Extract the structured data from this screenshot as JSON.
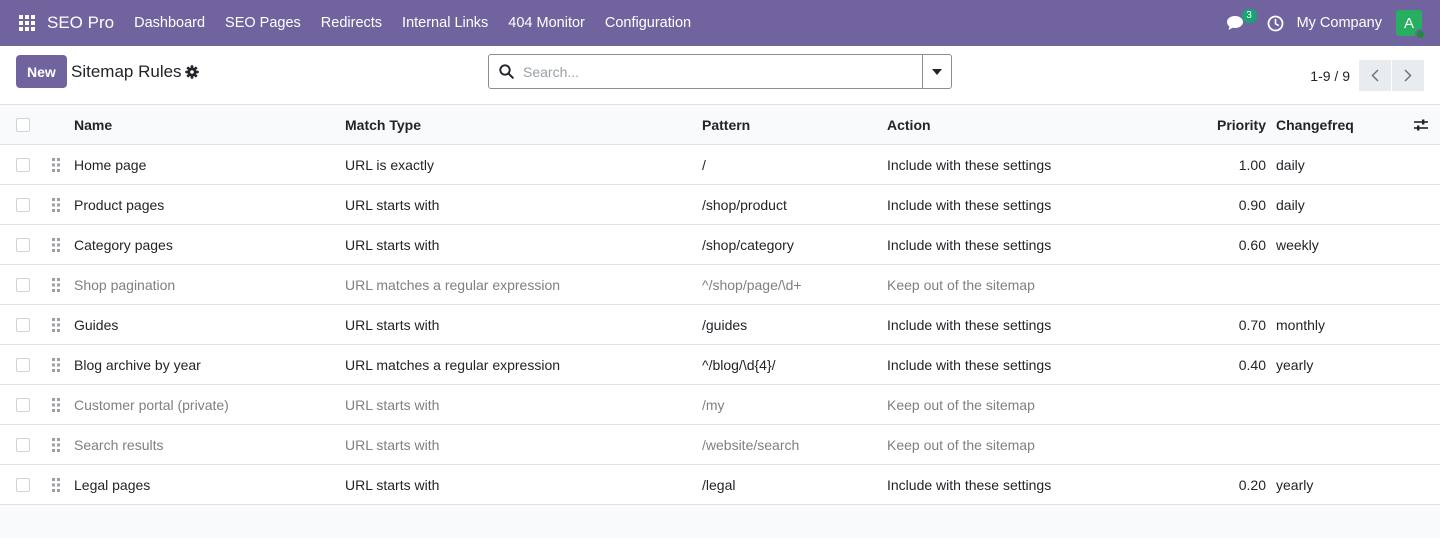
{
  "topbar": {
    "app_name": "SEO Pro",
    "menu": [
      "Dashboard",
      "SEO Pages",
      "Redirects",
      "Internal Links",
      "404 Monitor",
      "Configuration"
    ],
    "messages_count": "3",
    "company": "My Company",
    "avatar_letter": "A",
    "colors": {
      "bar": "#71639e",
      "avatar": "#27ae60",
      "badge": "#17a673"
    }
  },
  "control": {
    "new_label": "New",
    "title": "Sitemap Rules",
    "search_placeholder": "Search...",
    "pager": "1-9 / 9"
  },
  "table": {
    "columns": {
      "name": "Name",
      "match": "Match Type",
      "pattern": "Pattern",
      "action": "Action",
      "priority": "Priority",
      "freq": "Changefreq"
    },
    "rows": [
      {
        "name": "Home page",
        "match": "URL is exactly",
        "pattern": "/",
        "action": "Include with these settings",
        "priority": "1.00",
        "freq": "daily",
        "active": true
      },
      {
        "name": "Product pages",
        "match": "URL starts with",
        "pattern": "/shop/product",
        "action": "Include with these settings",
        "priority": "0.90",
        "freq": "daily",
        "active": true
      },
      {
        "name": "Category pages",
        "match": "URL starts with",
        "pattern": "/shop/category",
        "action": "Include with these settings",
        "priority": "0.60",
        "freq": "weekly",
        "active": true
      },
      {
        "name": "Shop pagination",
        "match": "URL matches a regular expression",
        "pattern": "^/shop/page/\\d+",
        "action": "Keep out of the sitemap",
        "priority": "",
        "freq": "",
        "active": false
      },
      {
        "name": "Guides",
        "match": "URL starts with",
        "pattern": "/guides",
        "action": "Include with these settings",
        "priority": "0.70",
        "freq": "monthly",
        "active": true
      },
      {
        "name": "Blog archive by year",
        "match": "URL matches a regular expression",
        "pattern": "^/blog/\\d{4}/",
        "action": "Include with these settings",
        "priority": "0.40",
        "freq": "yearly",
        "active": true
      },
      {
        "name": "Customer portal (private)",
        "match": "URL starts with",
        "pattern": "/my",
        "action": "Keep out of the sitemap",
        "priority": "",
        "freq": "",
        "active": false
      },
      {
        "name": "Search results",
        "match": "URL starts with",
        "pattern": "/website/search",
        "action": "Keep out of the sitemap",
        "priority": "",
        "freq": "",
        "active": false
      },
      {
        "name": "Legal pages",
        "match": "URL starts with",
        "pattern": "/legal",
        "action": "Include with these settings",
        "priority": "0.20",
        "freq": "yearly",
        "active": true
      }
    ]
  }
}
